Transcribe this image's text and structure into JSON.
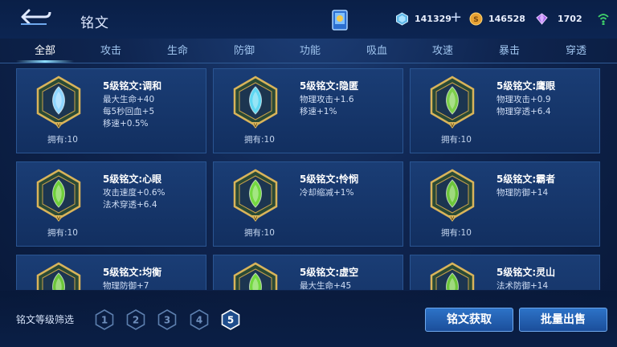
{
  "header": {
    "title": "铭文",
    "currencies": [
      {
        "icon": "diamond-gem-icon",
        "value": "141329"
      },
      {
        "icon": "gold-coin-icon",
        "value": "146528"
      },
      {
        "icon": "purple-crystal-icon",
        "value": "1702"
      }
    ]
  },
  "tabs": [
    "全部",
    "攻击",
    "生命",
    "防御",
    "功能",
    "吸血",
    "攻速",
    "暴击",
    "穿透"
  ],
  "active_tab": "全部",
  "cards": [
    {
      "name": "5级铭文:调和",
      "attrs": [
        "最大生命+40",
        "每5秒回血+5",
        "移速+0.5%"
      ],
      "owned": "拥有:10",
      "gem": "#8fd6ff"
    },
    {
      "name": "5级铭文:隐匿",
      "attrs": [
        "物理攻击+1.6",
        "移速+1%"
      ],
      "owned": "拥有:10",
      "gem": "#5fd8f2"
    },
    {
      "name": "5级铭文:鹰眼",
      "attrs": [
        "物理攻击+0.9",
        "物理穿透+6.4"
      ],
      "owned": "拥有:10",
      "gem": "#7ccf4a"
    },
    {
      "name": "5级铭文:心眼",
      "attrs": [
        "攻击速度+0.6%",
        "法术穿透+6.4"
      ],
      "owned": "拥有:10",
      "gem": "#6fcf3a"
    },
    {
      "name": "5级铭文:怜悯",
      "attrs": [
        "冷却缩减+1%"
      ],
      "owned": "拥有:10",
      "gem": "#74d940"
    },
    {
      "name": "5级铭文:霸者",
      "attrs": [
        "物理防御+14"
      ],
      "owned": "拥有:10",
      "gem": "#6cc63a"
    },
    {
      "name": "5级铭文:均衡",
      "attrs": [
        "物理防御+7"
      ],
      "owned": "",
      "gem": "#6cc63a"
    },
    {
      "name": "5级铭文:虚空",
      "attrs": [
        "最大生命+45"
      ],
      "owned": "",
      "gem": "#74d940"
    },
    {
      "name": "5级铭文:灵山",
      "attrs": [
        "法术防御+14"
      ],
      "owned": "",
      "gem": "#6cc63a"
    }
  ],
  "filter": {
    "label": "铭文等级筛选",
    "levels": [
      "1",
      "2",
      "3",
      "4",
      "5"
    ],
    "selected": "5"
  },
  "buttons": {
    "acquire": "铭文获取",
    "bulk_sell": "批量出售"
  }
}
